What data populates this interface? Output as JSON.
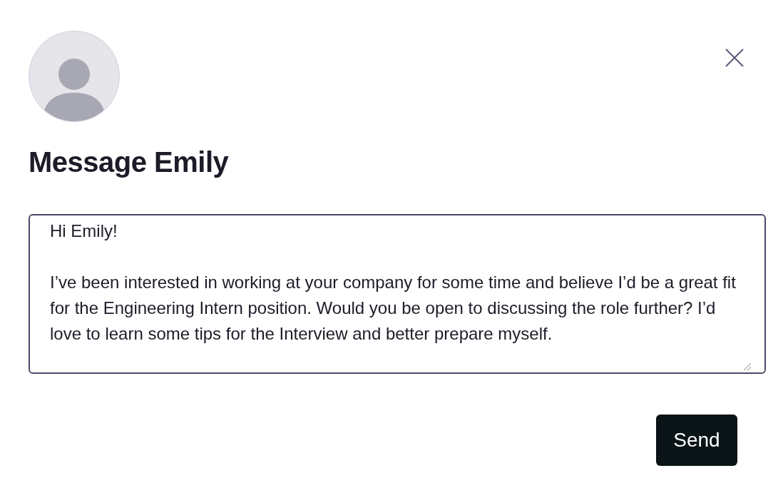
{
  "dialog": {
    "title": "Message Emily"
  },
  "message": {
    "value": "Hi Emily!\n\nI’ve been interested in working at your company for some time and believe I’d be a great fit for the Engineering Intern position. Would you be open to discussing the role further? I’d love to learn some tips for the Interview and better prepare myself."
  },
  "buttons": [
    {
      "label": "Send"
    }
  ]
}
